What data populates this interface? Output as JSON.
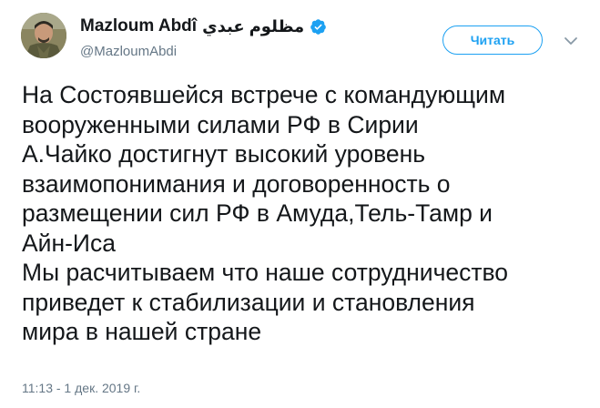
{
  "author": {
    "display_name": "Mazloum Abdî",
    "display_name_arabic": "مظلوم عبدي",
    "handle": "@MazloumAbdi",
    "verified": true,
    "verified_icon": "verified-badge-icon",
    "avatar": "avatar"
  },
  "actions": {
    "follow_label": "Читать",
    "menu_icon": "chevron-down-icon"
  },
  "tweet": {
    "lines": [
      "На Состоявшейся встрече с командующим",
      "вооруженными силами РФ в Сирии",
      "А.Чайко достигнут высокий уровень",
      "взаимопонимания и договоренность о",
      "размещении сил РФ в Амуда,Тель-Тамр и",
      "Айн-Иса",
      "Мы расчитываем что наше сотрудничество",
      "приведет к стабилизации и становления",
      "мира в нашей стране"
    ],
    "timestamp": "11:13 - 1 дек. 2019 г."
  },
  "colors": {
    "accent": "#1da1f2",
    "text": "#14171a",
    "secondary_text": "#657786"
  }
}
